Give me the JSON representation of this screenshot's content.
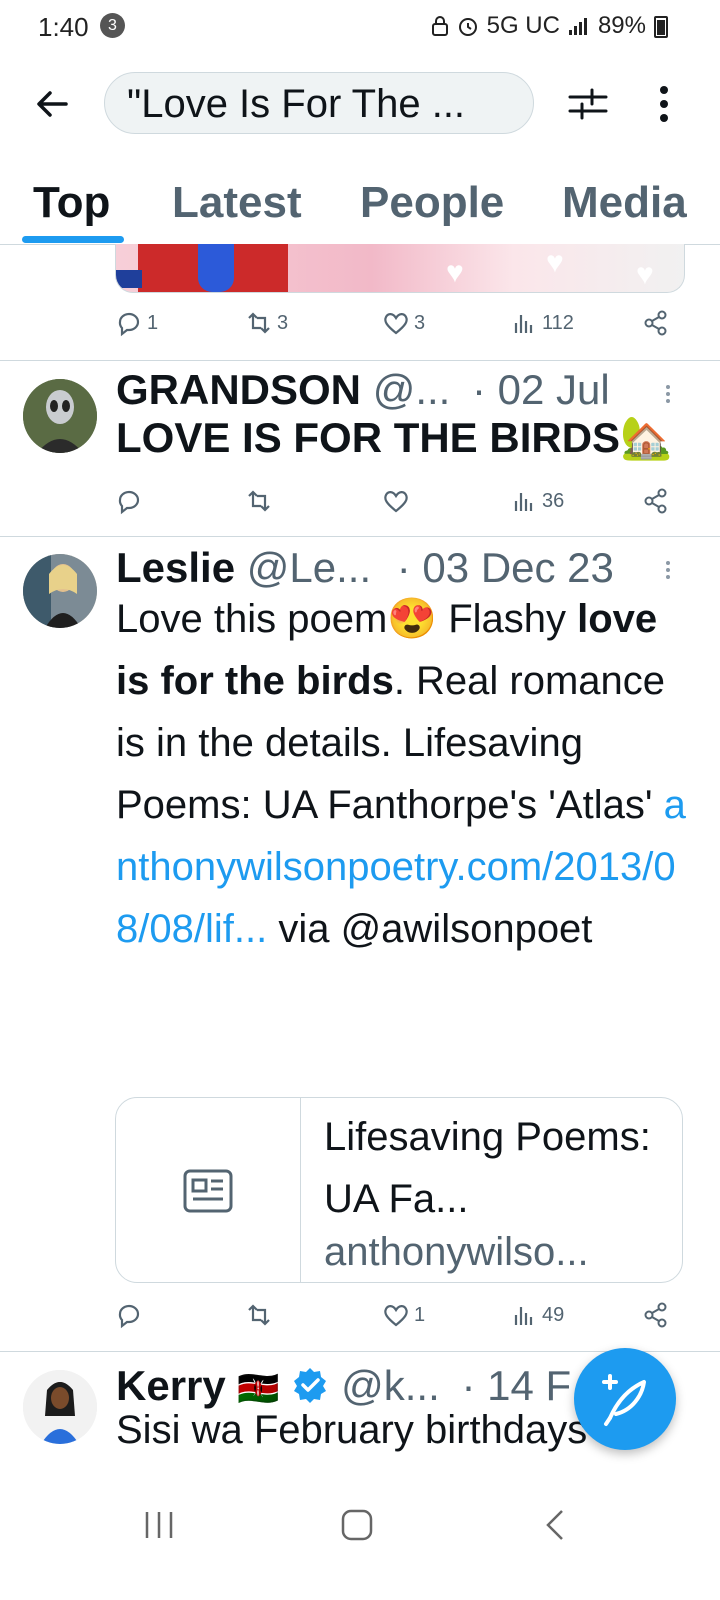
{
  "status_bar": {
    "time": "1:40",
    "notification_count": "3",
    "network": "5G UC",
    "battery": "89%"
  },
  "search": {
    "query": "\"Love Is For The ..."
  },
  "tabs": [
    {
      "label": "Top",
      "active": true
    },
    {
      "label": "Latest",
      "active": false
    },
    {
      "label": "People",
      "active": false
    },
    {
      "label": "Media",
      "active": false
    }
  ],
  "top_post": {
    "replies": "1",
    "reposts": "3",
    "likes": "3",
    "views": "112"
  },
  "tweets": [
    {
      "name": "GRANDSON",
      "handle": "@...",
      "date": "· 02 Jul",
      "text": "LOVE IS FOR THE BIRDS🏡",
      "stats": {
        "replies": "",
        "reposts": "",
        "likes": "",
        "views": "36"
      }
    },
    {
      "name": "Leslie",
      "handle": "@Le...",
      "date": "· 03 Dec 23",
      "text_a": "Love this poem😍 Flashy ",
      "text_bold": "love is for the birds",
      "text_b": ". Real romance is in the details. Lifesaving Poems: UA Fanthorpe's 'Atlas' ",
      "link": "anthonywilsonpoetry.com/2013/08/08/lif...",
      "text_c": " via @awilsonpoet",
      "card": {
        "title": "Lifesaving Poems: UA Fa...",
        "domain": "anthonywilso..."
      },
      "stats": {
        "replies": "",
        "reposts": "",
        "likes": "1",
        "views": "49"
      }
    },
    {
      "name": "Kerry",
      "flag": "🇰🇪",
      "handle": "@k...",
      "date": "· 14 F",
      "text": "Sisi wa February birthdays"
    }
  ],
  "colors": {
    "accent": "#1d9bf0",
    "text": "#0f1419",
    "secondary": "#536471"
  }
}
